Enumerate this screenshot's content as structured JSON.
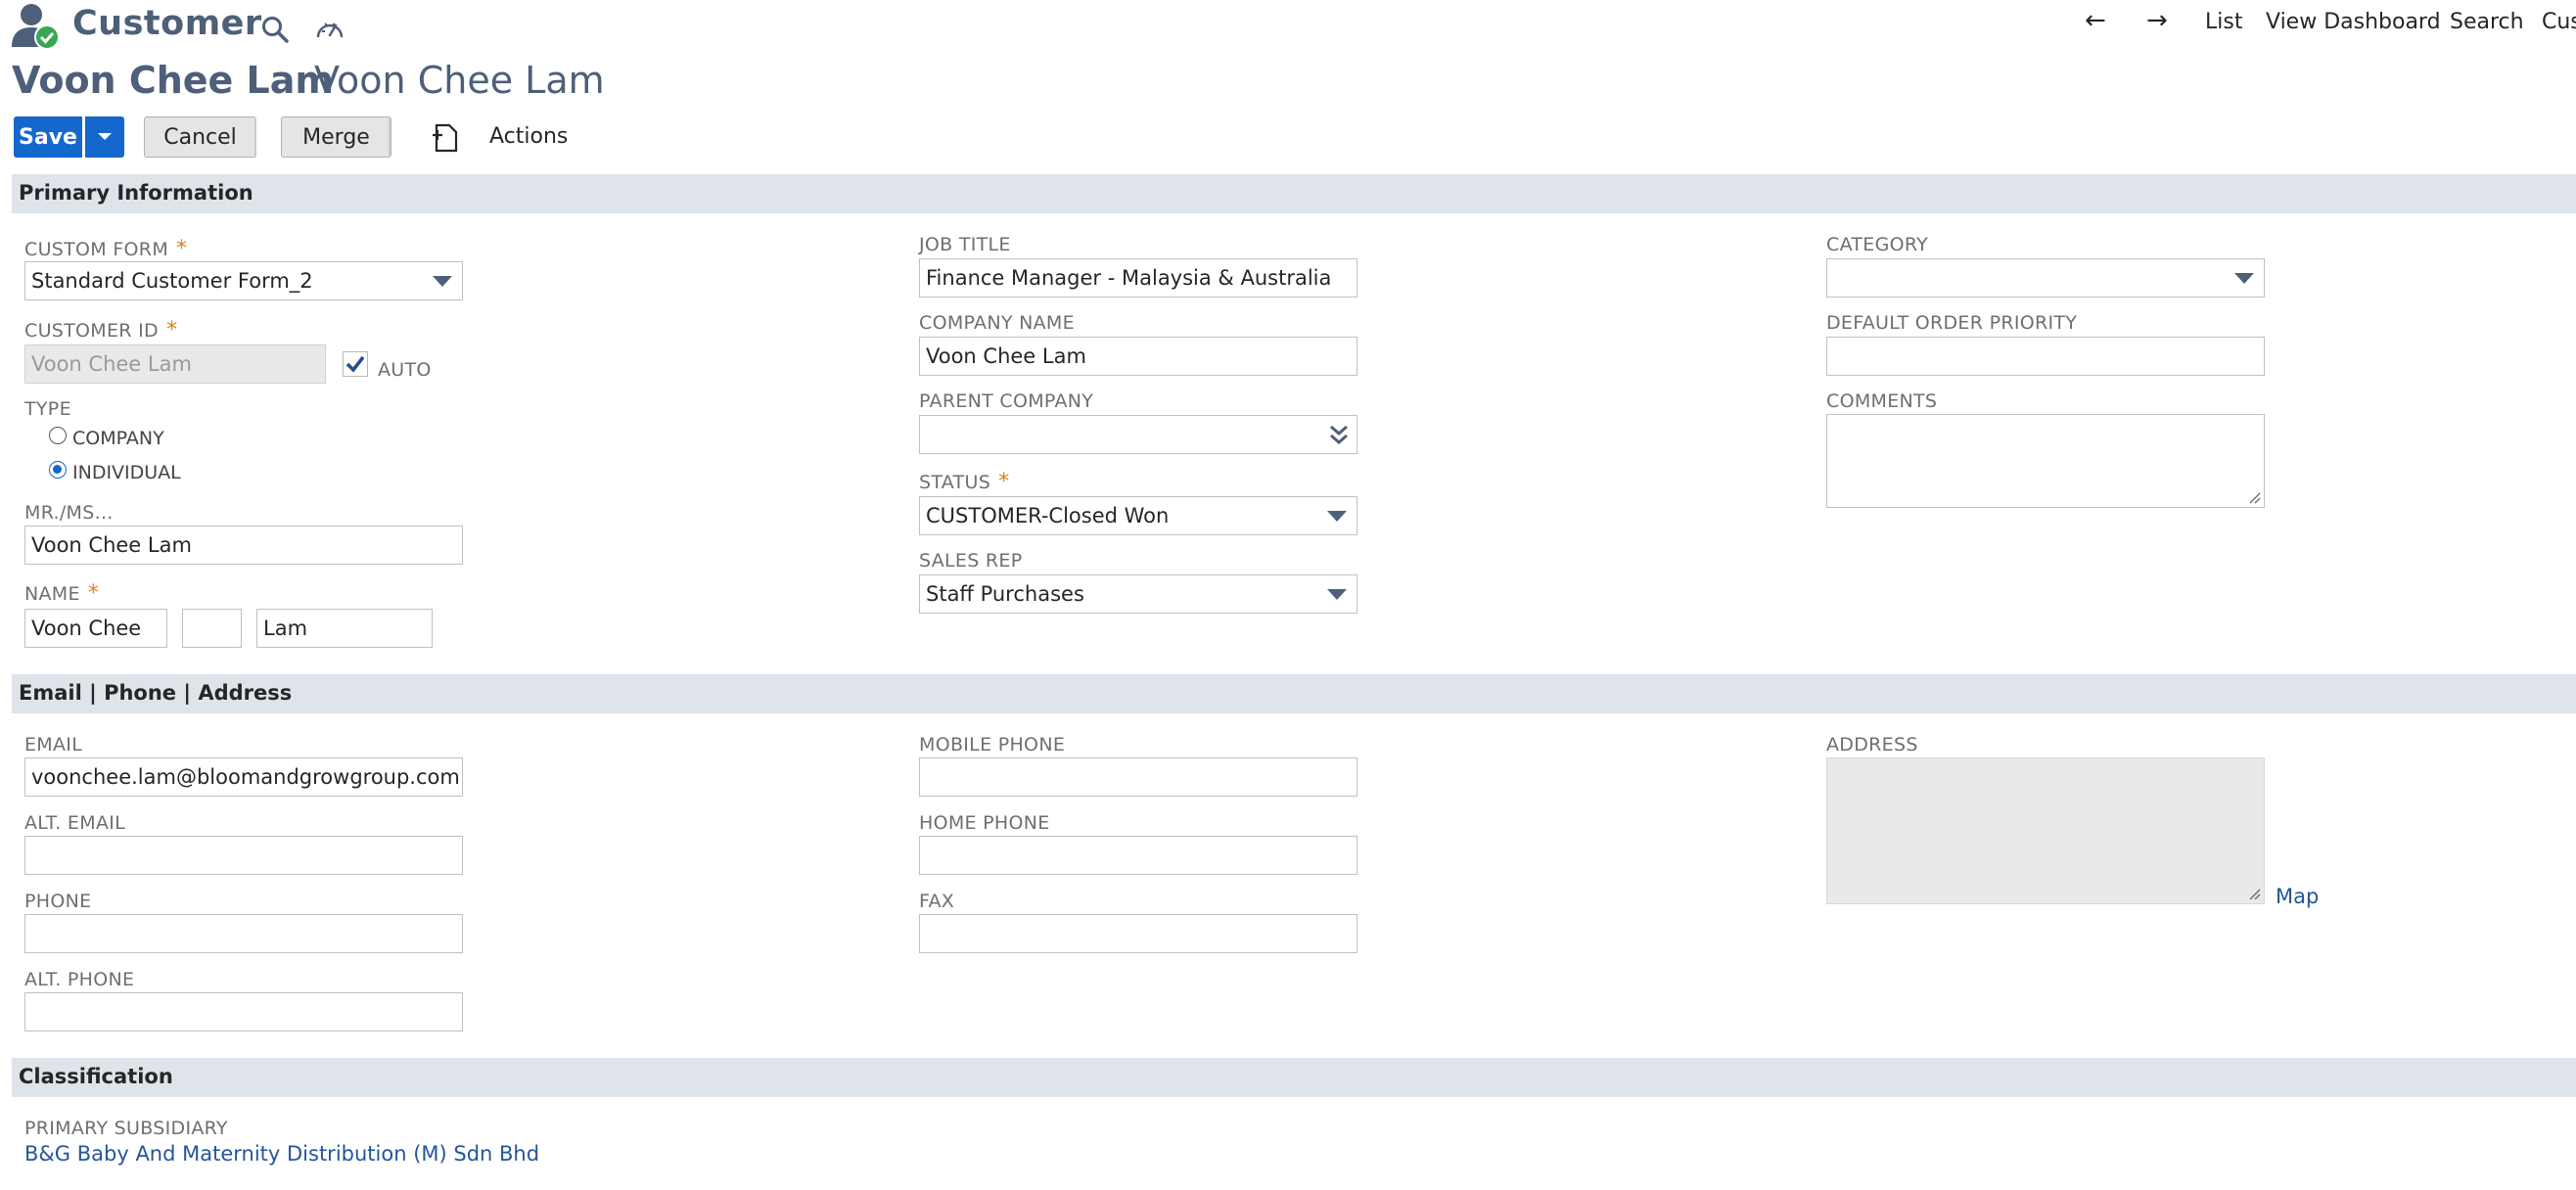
{
  "header": {
    "app_title": "Customer",
    "nav": {
      "back": "←",
      "forward": "→",
      "list": "List",
      "view_dashboard": "View Dashboard",
      "search": "Search",
      "customize": "Cus"
    }
  },
  "record": {
    "title": "Voon Chee Lam",
    "subtitle": "Voon Chee Lam"
  },
  "toolbar": {
    "save": "Save",
    "cancel": "Cancel",
    "merge": "Merge",
    "actions": "Actions"
  },
  "sections": {
    "primary": "Primary Information",
    "contact": "Email | Phone | Address",
    "classification": "Classification"
  },
  "primary": {
    "custom_form": {
      "label": "CUSTOM FORM",
      "value": "Standard Customer Form_2"
    },
    "customer_id": {
      "label": "CUSTOMER ID",
      "value": "Voon Chee Lam",
      "auto_label": "AUTO"
    },
    "type": {
      "label": "TYPE",
      "options": [
        "COMPANY",
        "INDIVIDUAL"
      ],
      "selected": "INDIVIDUAL"
    },
    "salutation": {
      "label": "MR./MS...",
      "value": "Voon Chee Lam"
    },
    "name": {
      "label": "NAME",
      "first": "Voon Chee",
      "middle": "",
      "last": "Lam"
    },
    "job_title": {
      "label": "JOB TITLE",
      "value": "Finance Manager - Malaysia & Australia"
    },
    "company_name": {
      "label": "COMPANY NAME",
      "value": "Voon Chee Lam"
    },
    "parent_company": {
      "label": "PARENT COMPANY",
      "value": ""
    },
    "status": {
      "label": "STATUS",
      "value": "CUSTOMER-Closed Won"
    },
    "sales_rep": {
      "label": "SALES REP",
      "value": "Staff Purchases"
    },
    "category": {
      "label": "CATEGORY",
      "value": ""
    },
    "default_order_priority": {
      "label": "DEFAULT ORDER PRIORITY",
      "value": ""
    },
    "comments": {
      "label": "COMMENTS",
      "value": ""
    }
  },
  "contact": {
    "email": {
      "label": "EMAIL",
      "value": "voonchee.lam@bloomandgrowgroup.com"
    },
    "alt_email": {
      "label": "ALT. EMAIL",
      "value": ""
    },
    "phone": {
      "label": "PHONE",
      "value": ""
    },
    "alt_phone": {
      "label": "ALT. PHONE",
      "value": ""
    },
    "mobile_phone": {
      "label": "MOBILE PHONE",
      "value": ""
    },
    "home_phone": {
      "label": "HOME PHONE",
      "value": ""
    },
    "fax": {
      "label": "FAX",
      "value": ""
    },
    "address": {
      "label": "ADDRESS",
      "map_link": "Map"
    }
  },
  "classification": {
    "primary_subsidiary": {
      "label": "PRIMARY SUBSIDIARY",
      "value": "B&G Baby And Maternity Distribution (M) Sdn Bhd"
    }
  },
  "colors": {
    "accent": "#1467cc",
    "title": "#4d5f79",
    "section_bg": "#dfe4eb",
    "required": "#e0801a",
    "link": "#255599"
  }
}
